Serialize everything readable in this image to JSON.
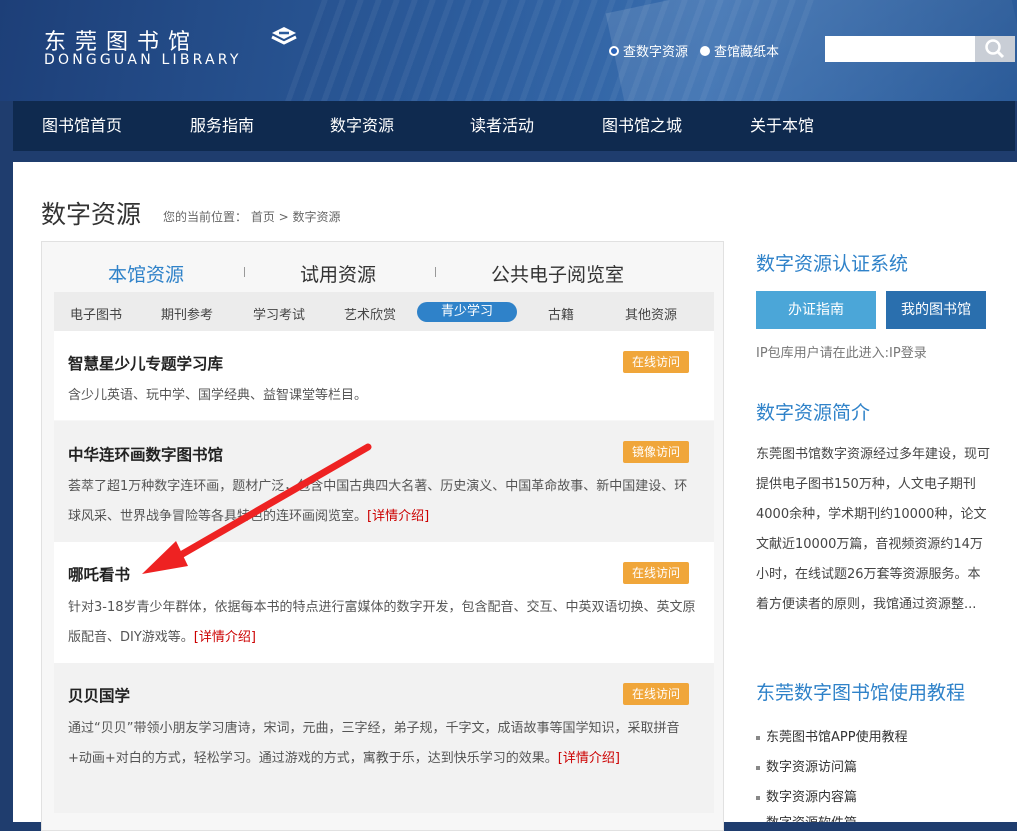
{
  "header": {
    "logo_cn": "东莞图书馆",
    "logo_en": "DONGGUAN LIBRARY",
    "radio_digital": "查数字资源",
    "radio_paper": "查馆藏纸本",
    "search_placeholder": ""
  },
  "nav": [
    "图书馆首页",
    "服务指南",
    "数字资源",
    "读者活动",
    "图书馆之城",
    "关于本馆"
  ],
  "page": {
    "title": "数字资源",
    "breadcrumb": "您的当前位置：  首页 >    数字资源"
  },
  "tabs": [
    "本馆资源",
    "试用资源",
    "公共电子阅览室"
  ],
  "subtabs": [
    "电子图书",
    "期刊参考",
    "学习考试",
    "艺术欣赏",
    "青少学习",
    "古籍",
    "其他资源"
  ],
  "resources": [
    {
      "title": "智慧星少儿专题学习库",
      "badge": "在线访问",
      "desc": "含少儿英语、玩中学、国学经典、益智课堂等栏目。",
      "more": ""
    },
    {
      "title": "中华连环画数字图书馆",
      "badge": "镜像访问",
      "desc": "荟萃了超1万种数字连环画，题材广泛，包含中国古典四大名著、历史演义、中国革命故事、新中国建设、环球风采、世界战争冒险等各具特色的连环画阅览室。",
      "more": "[详情介绍]"
    },
    {
      "title": "哪吒看书",
      "badge": "在线访问",
      "desc": "针对3-18岁青少年群体，依据每本书的特点进行富媒体的数字开发，包含配音、交互、中英双语切换、英文原版配音、DIY游戏等。",
      "more": "[详情介绍]"
    },
    {
      "title": "贝贝国学",
      "badge": "在线访问",
      "desc": "通过“贝贝”带领小朋友学习唐诗，宋词，元曲，三字经，弟子规，千字文，成语故事等国学知识，采取拼音+动画+对白的方式，轻松学习。通过游戏的方式，寓教于乐，达到快乐学习的效果。",
      "more": "[详情介绍]"
    }
  ],
  "sidebar": {
    "auth_title": "数字资源认证系统",
    "btn_guide": "办证指南",
    "btn_mylib": "我的图书馆",
    "ip_note": "IP包库用户请在此进入:IP登录",
    "intro_title": "数字资源简介",
    "intro_text": "东莞图书馆数字资源经过多年建设，现可提供电子图书150万种，人文电子期刊4000余种，学术期刊约10000种，论文文献近10000万篇，音视频资源约14万小时，在线试题26万套等资源服务。本着方便读者的原则，我馆通过资源整...",
    "tutorial_title": "东莞数字图书馆使用教程",
    "tutorials": [
      "东莞图书馆APP使用教程",
      "数字资源访问篇",
      "数字资源内容篇",
      "数字资源软件篇"
    ]
  },
  "colors": {
    "accent": "#2f82c9",
    "badge": "#f0a63a",
    "nav": "#0f2a4f",
    "link": "#cc0000"
  }
}
